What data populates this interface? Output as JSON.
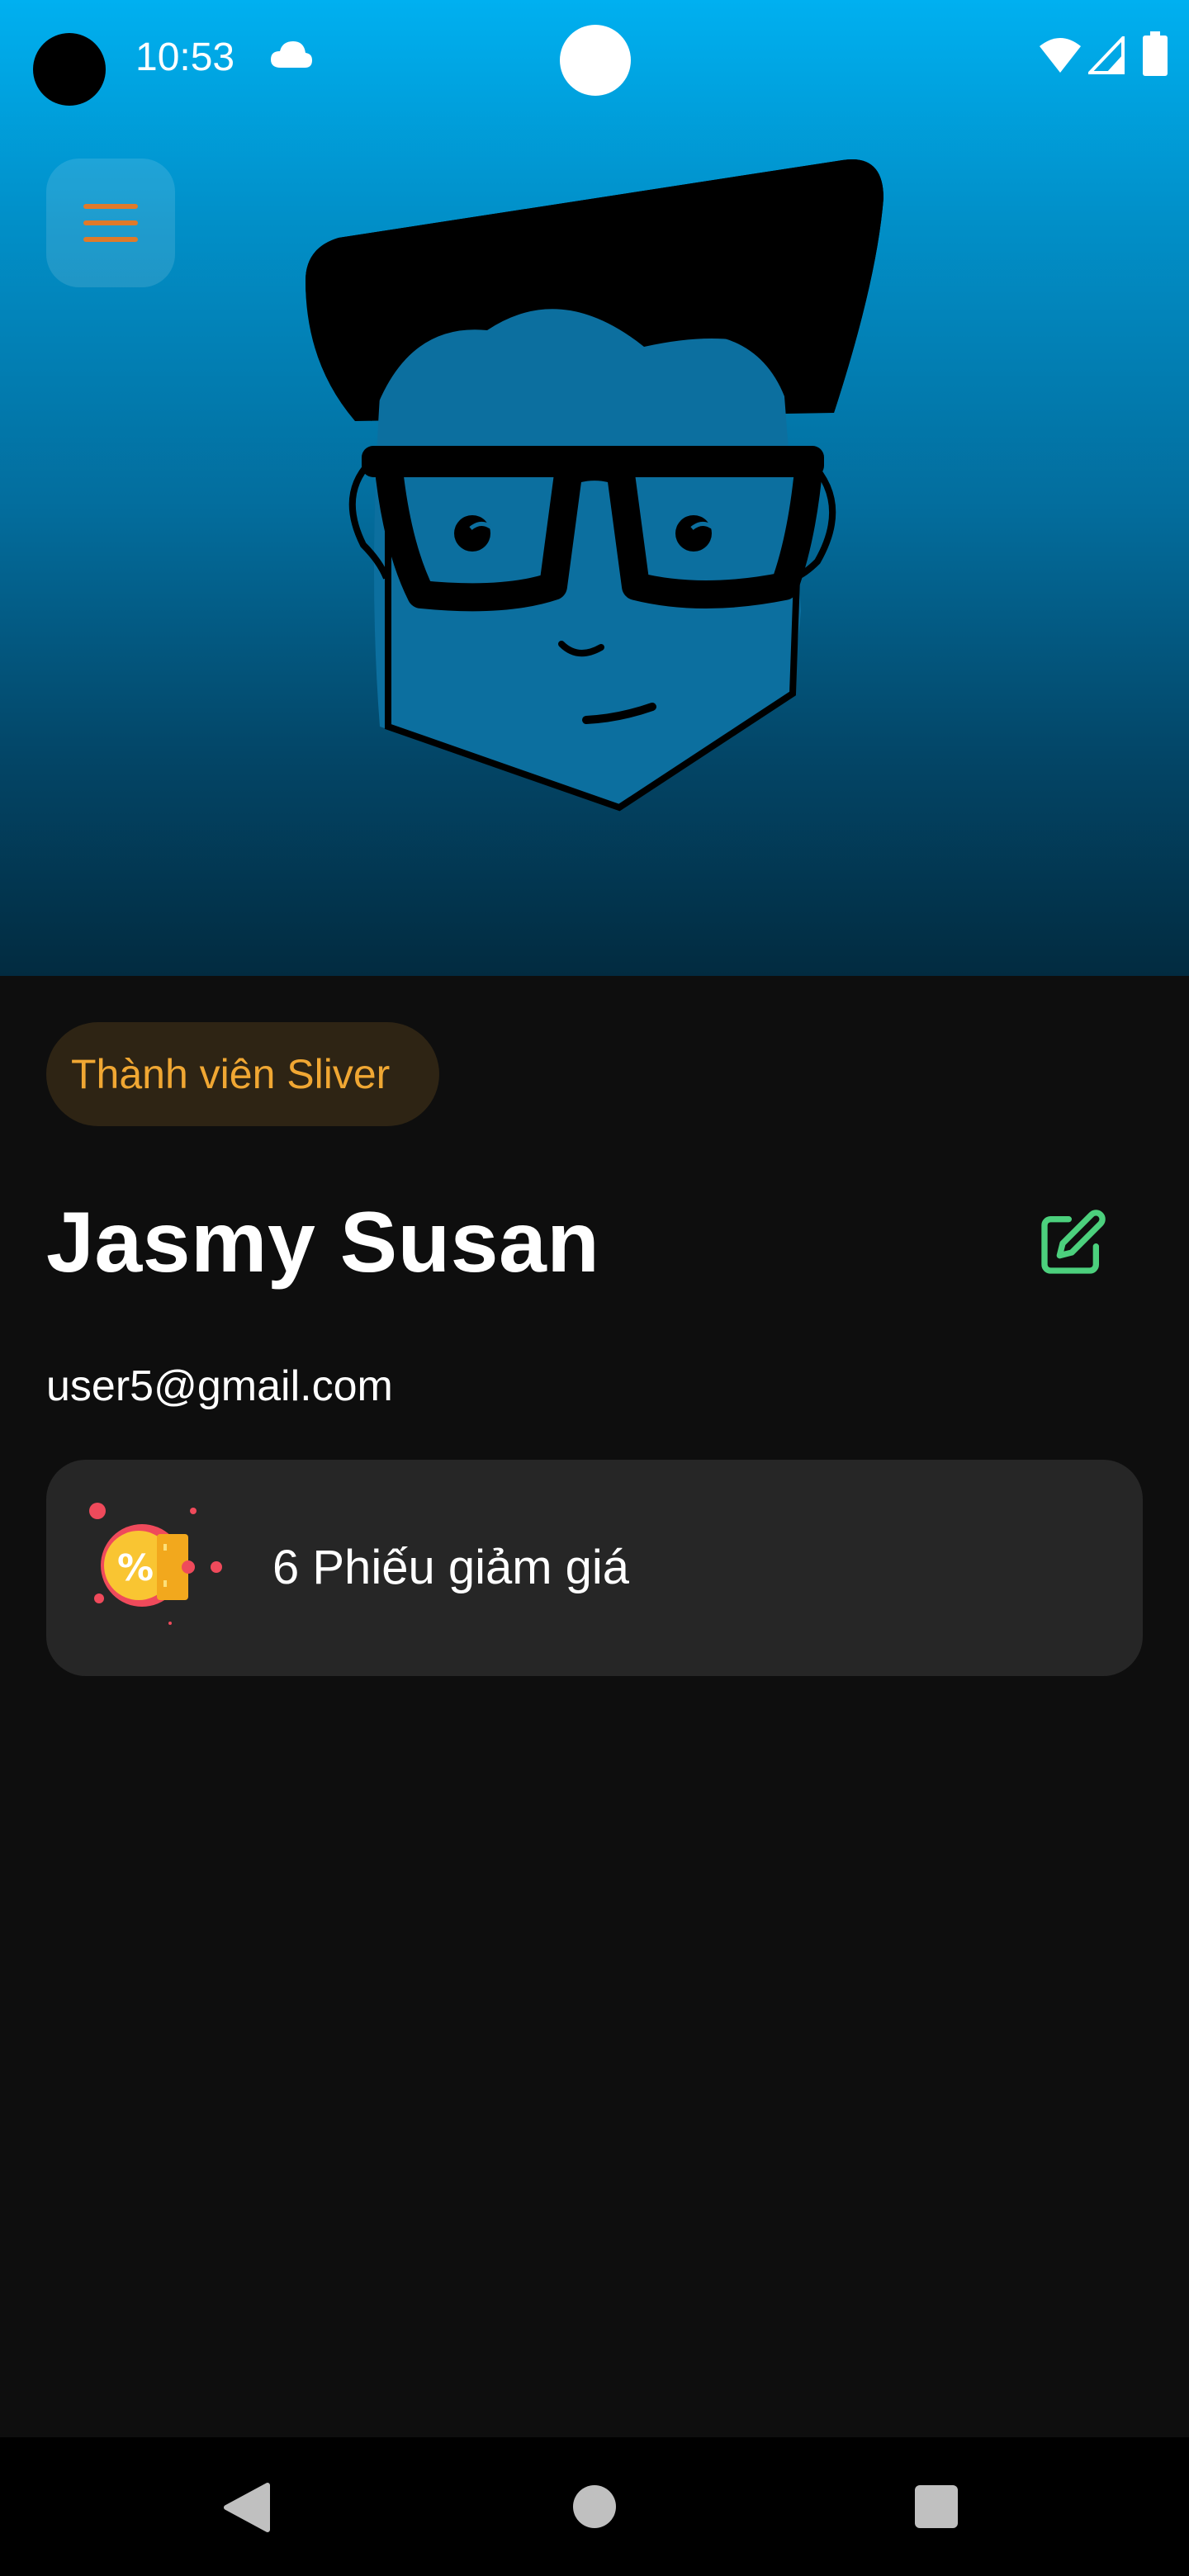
{
  "status_bar": {
    "time": "10:53",
    "icons": [
      "cloud-icon",
      "wifi-icon",
      "signal-icon",
      "battery-icon"
    ]
  },
  "header": {
    "menu_icon": "hamburger-menu-icon",
    "cover_colors": {
      "top": "#00b0f0",
      "bottom": "#022b40"
    }
  },
  "profile": {
    "membership_label": "Thành viên Sliver",
    "name": "Jasmy Susan",
    "email": "user5@gmail.com",
    "edit_icon": "edit-icon"
  },
  "voucher": {
    "label": "6 Phiếu giảm giá",
    "icon": "discount-voucher-icon"
  },
  "nav_bar": {
    "icons": [
      "back-icon",
      "home-icon",
      "recents-icon"
    ]
  },
  "colors": {
    "accent_orange": "#f0a733",
    "badge_bg": "#2e2414",
    "edit_green": "#4cd07d",
    "card_bg": "#262626",
    "page_bg": "#0e0e0e"
  }
}
